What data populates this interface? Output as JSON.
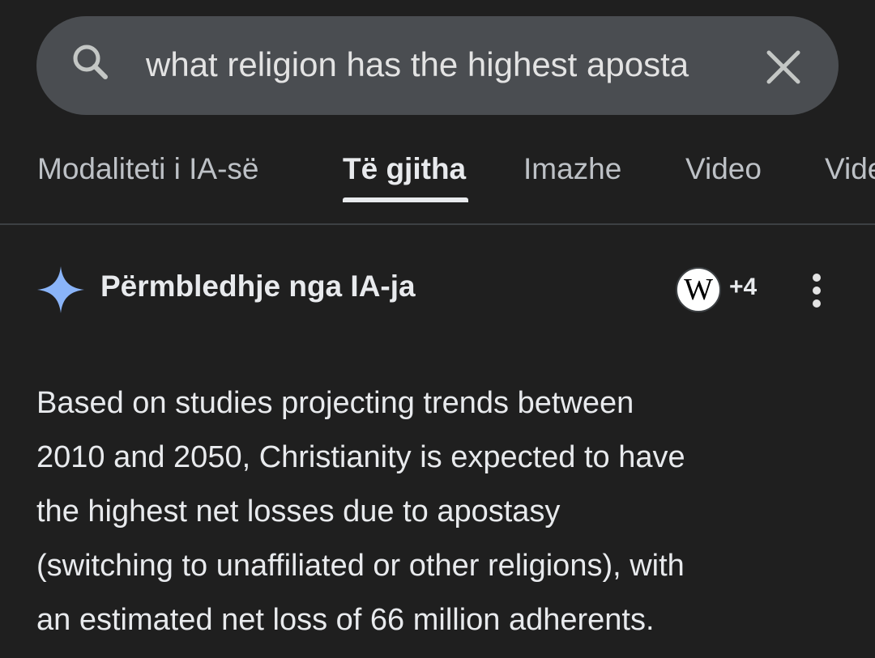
{
  "search": {
    "query": "what religion has the highest aposta"
  },
  "tabs": [
    {
      "label": "Modaliteti i IA-së",
      "active": false
    },
    {
      "label": "Të gjitha",
      "active": true
    },
    {
      "label": "Imazhe",
      "active": false
    },
    {
      "label": "Video",
      "active": false
    },
    {
      "label": "Vide",
      "active": false
    }
  ],
  "ai_overview": {
    "title": "Përmbledhje nga IA-ja",
    "source_badge": "W",
    "source_count": "+4",
    "answer_lines": [
      "Based on studies projecting trends between",
      "2010 and 2050, Christianity is expected to have",
      "the highest net losses due to apostasy",
      "(switching to unaffiliated or other religions), with",
      "an estimated net loss of 66 million adherents."
    ]
  },
  "icons": {
    "search": "search-icon",
    "clear": "close-icon",
    "sparkle": "sparkle-icon",
    "more": "more-vert-icon"
  },
  "colors": {
    "background": "#1f1f1f",
    "search_bar": "#4a4d51",
    "sparkle": "#8ab4f8"
  }
}
